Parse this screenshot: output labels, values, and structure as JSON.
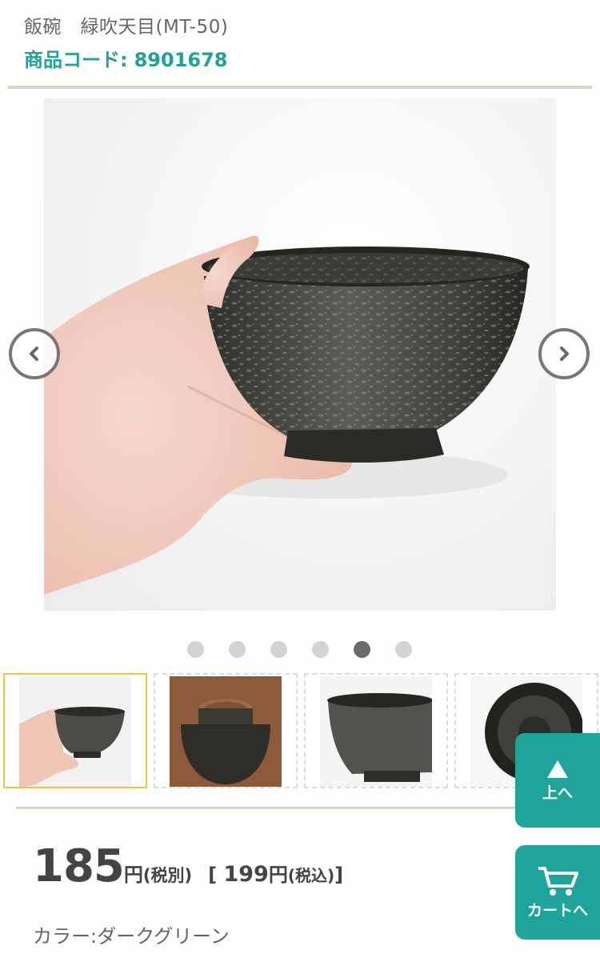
{
  "product": {
    "title": "飯碗　緑吹天目(MT-50)",
    "code_label": "商品コード:",
    "code_value": "8901678"
  },
  "gallery": {
    "dots_count": 6,
    "active_dot": 4,
    "thumbnails": [
      "thumb-hand-bowl",
      "thumb-bowl-bottom",
      "thumb-bowl-side",
      "thumb-bowl-top"
    ],
    "selected_thumbnail": 0,
    "prev_icon": "chevron-left-icon",
    "next_icon": "chevron-right-icon"
  },
  "price": {
    "amount": "185",
    "yen": "円",
    "tax_excl": "(税別)",
    "incl_open": "[ ",
    "incl_amount": "199",
    "incl_yen": "円",
    "incl_tax": "(税込)",
    "incl_close": "]"
  },
  "color": {
    "text": "カラー:ダークグリーン"
  },
  "floating": {
    "top_label": "上へ",
    "top_icon": "triangle-up-icon",
    "cart_label": "カートへ",
    "cart_icon": "cart-icon"
  },
  "colors": {
    "accent": "#1ea49a",
    "code_text": "#22a196",
    "selected_border": "#f0c64a"
  }
}
